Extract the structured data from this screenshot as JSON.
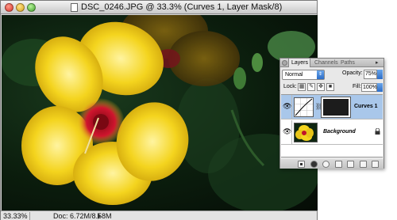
{
  "window": {
    "title": "DSC_0246.JPG @ 33.3% (Curves 1, Layer Mask/8)"
  },
  "statusbar": {
    "zoom": "33.33%",
    "doc_info": "Doc: 6.72M/8.58M"
  },
  "layers_panel": {
    "tabs": [
      "Layers",
      "Channels",
      "Paths"
    ],
    "active_tab": "Layers",
    "blend_mode": "Normal",
    "opacity_label": "Opacity:",
    "opacity_value": "75%",
    "lock_label": "Lock:",
    "fill_label": "Fill:",
    "fill_value": "100%",
    "layers": [
      {
        "name": "Curves 1",
        "selected": true,
        "visible": true
      },
      {
        "name": "Background",
        "selected": false,
        "visible": true,
        "locked": true
      }
    ]
  },
  "colors": {
    "selection": "#a9c7ea",
    "accent_blue": "#2d6dc7",
    "flower_yellow": "#f2d21c",
    "flower_center": "#c0122a"
  },
  "icons": {
    "window_controls": [
      "close-icon",
      "minimize-icon",
      "zoom-icon"
    ],
    "layer_visibility": "eye-icon",
    "link": "chain-icon",
    "lock": "lock-icon"
  }
}
